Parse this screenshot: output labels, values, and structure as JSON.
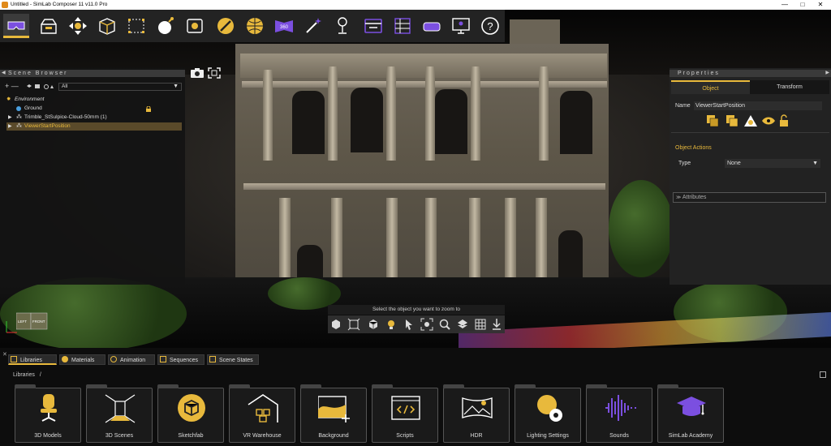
{
  "window": {
    "title": "Untitled - SimLab Composer 11 v11.0 Pro",
    "minimize": "—",
    "maximize": "□",
    "close": "✕"
  },
  "toolbar": {
    "items": [
      {
        "name": "vr-headset-icon"
      },
      {
        "name": "open-box-icon"
      },
      {
        "name": "move-arrows-icon"
      },
      {
        "name": "cube-icon"
      },
      {
        "name": "selection-box-icon"
      },
      {
        "name": "bomb-icon"
      },
      {
        "name": "snapshot-icon"
      },
      {
        "name": "no-entry-icon"
      },
      {
        "name": "globe-icon"
      },
      {
        "name": "panorama-360-icon"
      },
      {
        "name": "magic-wand-icon"
      },
      {
        "name": "light-stand-icon"
      },
      {
        "name": "toggle-panel-icon"
      },
      {
        "name": "table-grid-icon"
      },
      {
        "name": "vr-goggles-icon"
      },
      {
        "name": "presentation-screen-icon"
      },
      {
        "name": "help-icon"
      }
    ],
    "help_glyph": "?",
    "pano_label": "360",
    "accent": "#e8b93c",
    "purple": "#7b4fe0"
  },
  "scene_browser": {
    "title": "Scene Browser",
    "tools": "+ —",
    "filter": "All",
    "tree": [
      {
        "label": "Environment",
        "level": 0
      },
      {
        "label": "Ground",
        "level": 1
      },
      {
        "label": "Trimble_StSulpice-Cloud-50mm (1)",
        "level": 1
      },
      {
        "label": "ViewerStartPosition",
        "level": 1,
        "selected": true
      }
    ]
  },
  "properties": {
    "title": "Properties",
    "tabs": [
      "Object",
      "Transform"
    ],
    "name_label": "Name",
    "name_value": "ViewerStartPosition",
    "object_actions_label": "Object Actions",
    "type_label": "Type",
    "type_value": "None",
    "attributes_label": "Attributes"
  },
  "viewport": {
    "zoom_hint": "Select the object you want to zoom to",
    "viewcube_left": "LEFT",
    "viewcube_front": "FRONT"
  },
  "bottom": {
    "tabs": [
      "Libraries",
      "Materials",
      "Animation",
      "Sequences",
      "Scene States"
    ],
    "breadcrumb": "Libraries",
    "breadcrumb_sep": "/",
    "cards": [
      {
        "label": "3D Models",
        "icon": "office-chair-icon"
      },
      {
        "label": "3D Scenes",
        "icon": "room-perspective-icon"
      },
      {
        "label": "Sketchfab",
        "icon": "sketchfab-icon"
      },
      {
        "label": "VR Warehouse",
        "icon": "warehouse-icon"
      },
      {
        "label": "Background",
        "icon": "background-image-icon"
      },
      {
        "label": "Scripts",
        "icon": "code-script-icon"
      },
      {
        "label": "HDR",
        "icon": "hdr-panorama-icon"
      },
      {
        "label": "Lighting Settings",
        "icon": "lighting-settings-icon"
      },
      {
        "label": "Sounds",
        "icon": "sound-wave-icon"
      },
      {
        "label": "SimLab Academy",
        "icon": "graduation-cap-icon"
      }
    ]
  }
}
